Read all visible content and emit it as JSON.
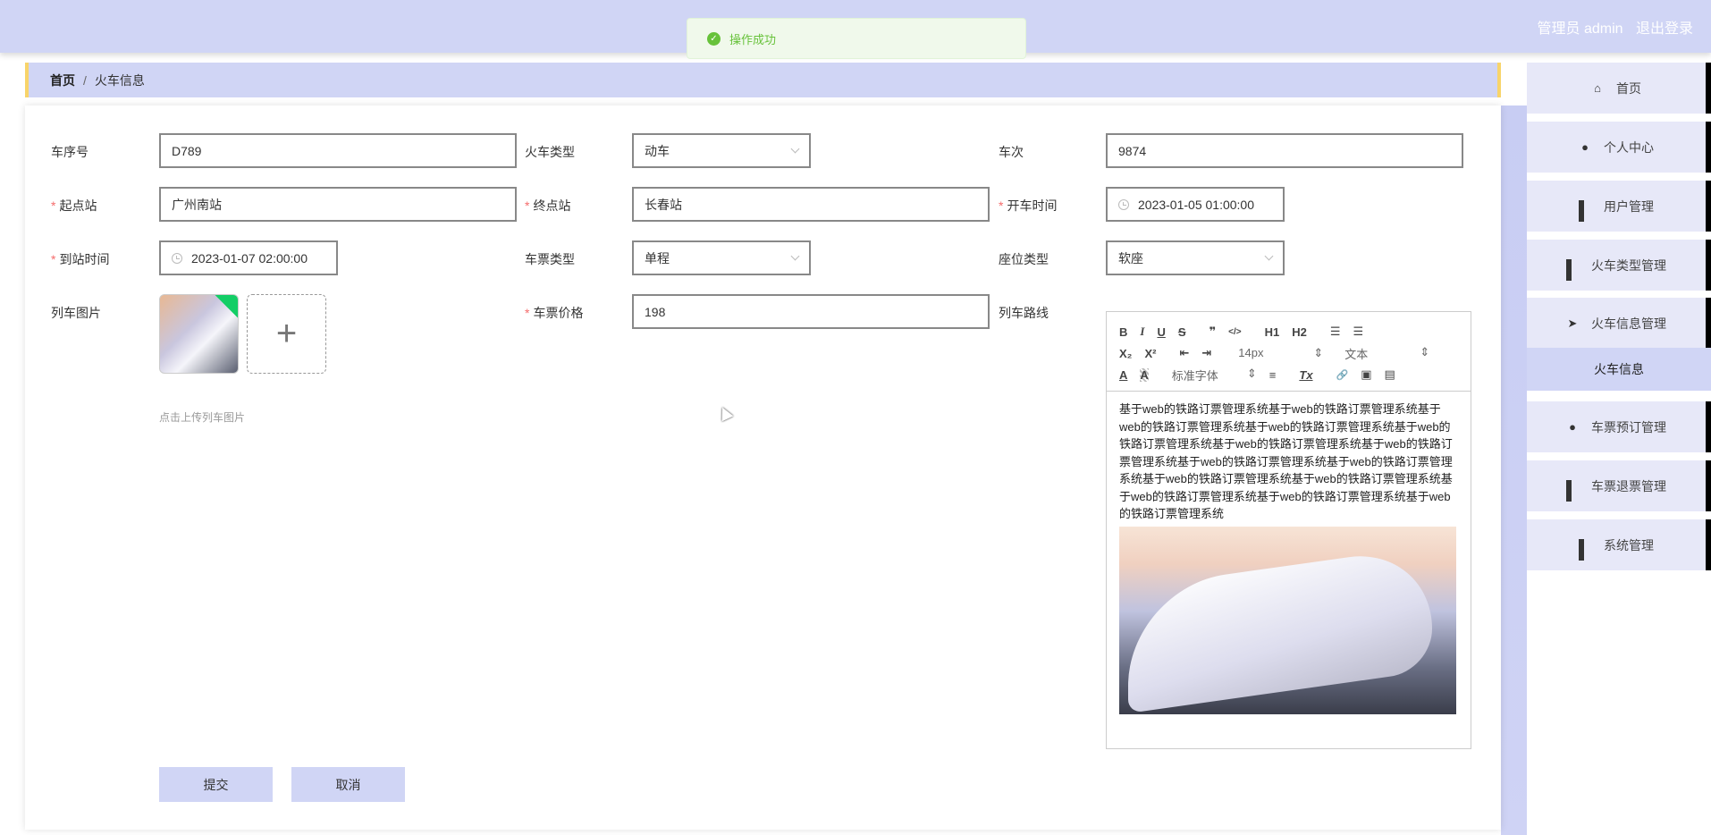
{
  "header": {
    "user_label": "管理员 admin",
    "logout": "退出登录"
  },
  "toast": {
    "message": "操作成功",
    "icon": "check-circle-icon",
    "color": "#67c23a"
  },
  "breadcrumb": {
    "home": "首页",
    "separator": "/",
    "current": "火车信息"
  },
  "form": {
    "train_no": {
      "label": "车序号",
      "value": "D789"
    },
    "train_type": {
      "label": "火车类型",
      "value": "动车"
    },
    "trips": {
      "label": "车次",
      "value": "9874"
    },
    "start": {
      "label": "起点站",
      "value": "广州南站",
      "required": "*"
    },
    "end": {
      "label": "终点站",
      "value": "长春站",
      "required": "*"
    },
    "depart": {
      "label": "开车时间",
      "value": "2023-01-05 01:00:00",
      "required": "*"
    },
    "arrive": {
      "label": "到站时间",
      "value": "2023-01-07 02:00:00",
      "required": "*"
    },
    "ticket_type": {
      "label": "车票类型",
      "value": "单程"
    },
    "seat_type": {
      "label": "座位类型",
      "value": "软座"
    },
    "image": {
      "label": "列车图片",
      "hint": "点击上传列车图片"
    },
    "price": {
      "label": "车票价格",
      "value": "198",
      "required": "*"
    },
    "route": {
      "label": "列车路线"
    },
    "submit": "提交",
    "cancel": "取消"
  },
  "editor": {
    "toolbar": {
      "bold": "B",
      "italic": "I",
      "underline": "U",
      "strike": "S",
      "quote": "❞",
      "code": "</>",
      "h1": "H1",
      "h2": "H2",
      "ol": "☰",
      "ul": "☰",
      "sub": "X₂",
      "sup": "X²",
      "outdent": "⇤",
      "indent": "⇥",
      "size": "14px",
      "header": "文本",
      "color": "A",
      "bg": "A",
      "font": "标准字体",
      "align": "≡",
      "clean": "Tx",
      "link": "🔗",
      "image": "▣",
      "video": "▤"
    },
    "content": "基于web的铁路订票管理系统基于web的铁路订票管理系统基于web的铁路订票管理系统基于web的铁路订票管理系统基于web的铁路订票管理系统基于web的铁路订票管理系统基于web的铁路订票管理系统基于web的铁路订票管理系统基于web的铁路订票管理系统基于web的铁路订票管理系统基于web的铁路订票管理系统基于web的铁路订票管理系统基于web的铁路订票管理系统基于web的铁路订票管理系统"
  },
  "sidebar": {
    "items": [
      {
        "label": "首页",
        "icon": "home-icon"
      },
      {
        "label": "个人中心",
        "icon": "user-icon"
      },
      {
        "label": "用户管理",
        "icon": "grid-icon"
      },
      {
        "label": "火车类型管理",
        "icon": "grid-icon"
      },
      {
        "label": "火车信息管理",
        "icon": "paper-plane-icon"
      },
      {
        "label": "火车信息"
      },
      {
        "label": "车票预订管理",
        "icon": "user-icon"
      },
      {
        "label": "车票退票管理",
        "icon": "grid-icon"
      },
      {
        "label": "系统管理",
        "icon": "grid-icon"
      }
    ]
  }
}
